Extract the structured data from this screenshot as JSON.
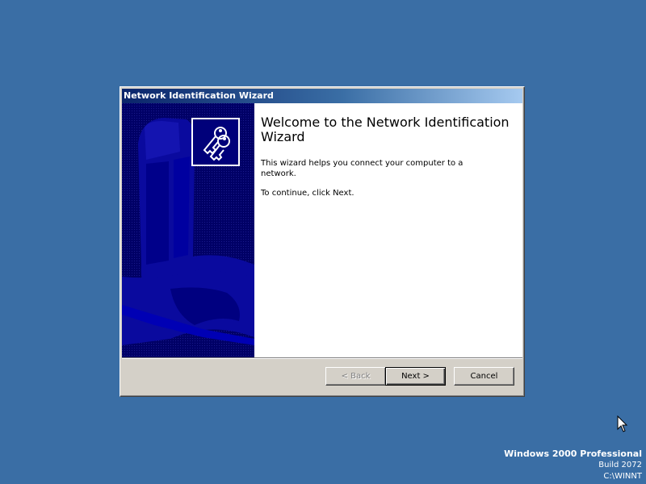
{
  "window": {
    "title": "Network Identification Wizard"
  },
  "wizard": {
    "heading": "Welcome to the Network Identification Wizard",
    "description": "This wizard helps you connect your computer to a network.",
    "instruction": "To continue, click Next."
  },
  "buttons": {
    "back_label": "< Back",
    "back_enabled": false,
    "next_label": "Next >",
    "cancel_label": "Cancel"
  },
  "icons": {
    "header_icon": "keys-icon",
    "pointer": "mouse-cursor-icon"
  },
  "desktop": {
    "product": "Windows 2000 Professional",
    "build": "Build 2072",
    "path": "C:\\WINNT"
  },
  "colors": {
    "desktop_background": "#3a6ea5",
    "titlebar_start": "#0a246a",
    "titlebar_end": "#a6caf0",
    "side_panel": "#00007a",
    "dialog_face": "#d4d0c8"
  }
}
